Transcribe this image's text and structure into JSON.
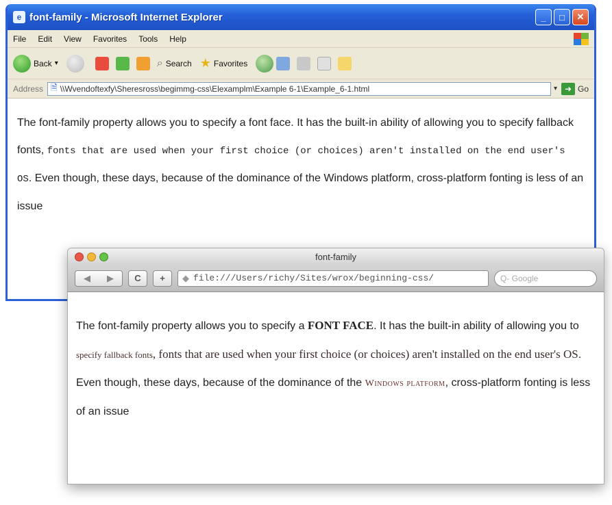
{
  "ie": {
    "title": "font-family - Microsoft Internet Explorer",
    "menu": [
      "File",
      "Edit",
      "View",
      "Favorites",
      "Tools",
      "Help"
    ],
    "toolbar": {
      "back": "Back",
      "search": "Search",
      "favorites": "Favorites"
    },
    "address": {
      "label": "Address",
      "value": "\\\\Wvendoftexfy\\Sheresross\\begimmg-css\\Elexamplm\\Example 6-1\\Example_6-1.html",
      "go": "Go"
    },
    "content": {
      "t1": "The font-family property allows you to specify a font face. It has the built-in ability of allowing you to specify fallback fonts, ",
      "mono": "fonts that are used when your first choice (or choices) aren't installed on the end user's OS",
      "t2": ". Even though, these days, because of the dominance of the Windows platform, cross-platform fonting is less of an issue"
    }
  },
  "mac": {
    "title": "font-family",
    "url": "file:///Users/richy/Sites/wrox/beginning-css/",
    "search_placeholder": "Q- Google",
    "content": {
      "t1": "The font-family property allows you to specify a ",
      "b1": "font face",
      "t2": ". It has the built-in ability of allowing you to ",
      "s1": "specify fallback fonts",
      "t3": ", fonts that are used when your first choice (or choices) aren't installed on the end user's OS",
      "t4": ". Even though, these days, because of the dominance of the ",
      "s2": "Windows platform",
      "t5": ", cross-platform fonting is less of an issue"
    }
  },
  "colors": {
    "xp_blue": "#2560d8",
    "xp_close": "#d6471f",
    "mac_red": "#e8584a",
    "mac_yellow": "#f2b83a",
    "mac_green": "#67c248"
  }
}
